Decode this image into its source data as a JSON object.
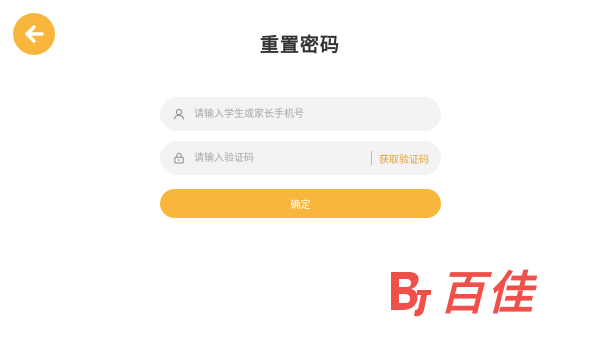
{
  "header": {
    "title": "重置密码",
    "back_icon": "arrow-left-icon"
  },
  "form": {
    "phone": {
      "placeholder": "请输入学生或家长手机号",
      "value": "",
      "icon": "user-icon"
    },
    "code": {
      "placeholder": "请输入验证码",
      "value": "",
      "icon": "lock-icon",
      "get_code_label": "获取验证码"
    },
    "confirm_label": "确定"
  },
  "watermark": {
    "text": "百佳"
  },
  "colors": {
    "accent": "#f8b73c",
    "field_bg": "#f3f3f3",
    "watermark": "#f0504a"
  }
}
